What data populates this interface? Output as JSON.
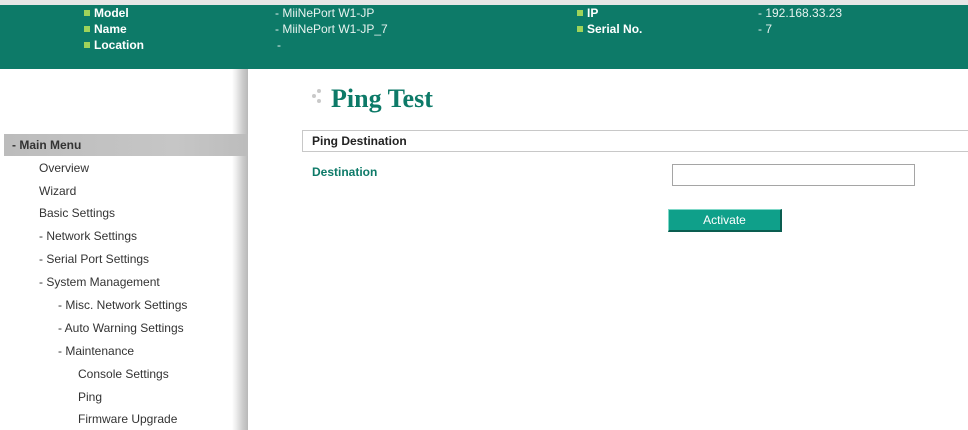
{
  "header": {
    "model_label": "Model",
    "model_value": "- MiiNePort W1-JP",
    "name_label": "Name",
    "name_value": "- MiiNePort W1-JP_7",
    "location_label": "Location",
    "location_value": "-",
    "ip_label": "IP",
    "ip_value": "- 192.168.33.23",
    "serial_label": "Serial No.",
    "serial_value": "- 7"
  },
  "sidebar": {
    "title": "- Main Menu",
    "items": [
      {
        "label": "Overview"
      },
      {
        "label": "Wizard"
      },
      {
        "label": "Basic Settings"
      },
      {
        "label": "- Network Settings"
      },
      {
        "label": "- Serial Port Settings"
      },
      {
        "label": "- System Management"
      },
      {
        "label": "- Misc. Network Settings"
      },
      {
        "label": "- Auto Warning Settings"
      },
      {
        "label": "- Maintenance"
      },
      {
        "label": "Console Settings"
      },
      {
        "label": "Ping"
      },
      {
        "label": "Firmware Upgrade"
      }
    ]
  },
  "main": {
    "page_title": "Ping Test",
    "section_title": "Ping Destination",
    "destination_label": "Destination",
    "destination_value": "",
    "activate_button": "Activate"
  },
  "colors": {
    "brand_green": "#0d7a68",
    "bullet_green": "#9fd35a",
    "button_green": "#0fa08a"
  },
  "icons": {
    "header_bullet": "green-square-bullet-icon",
    "title_decoration": "dots-icon"
  }
}
